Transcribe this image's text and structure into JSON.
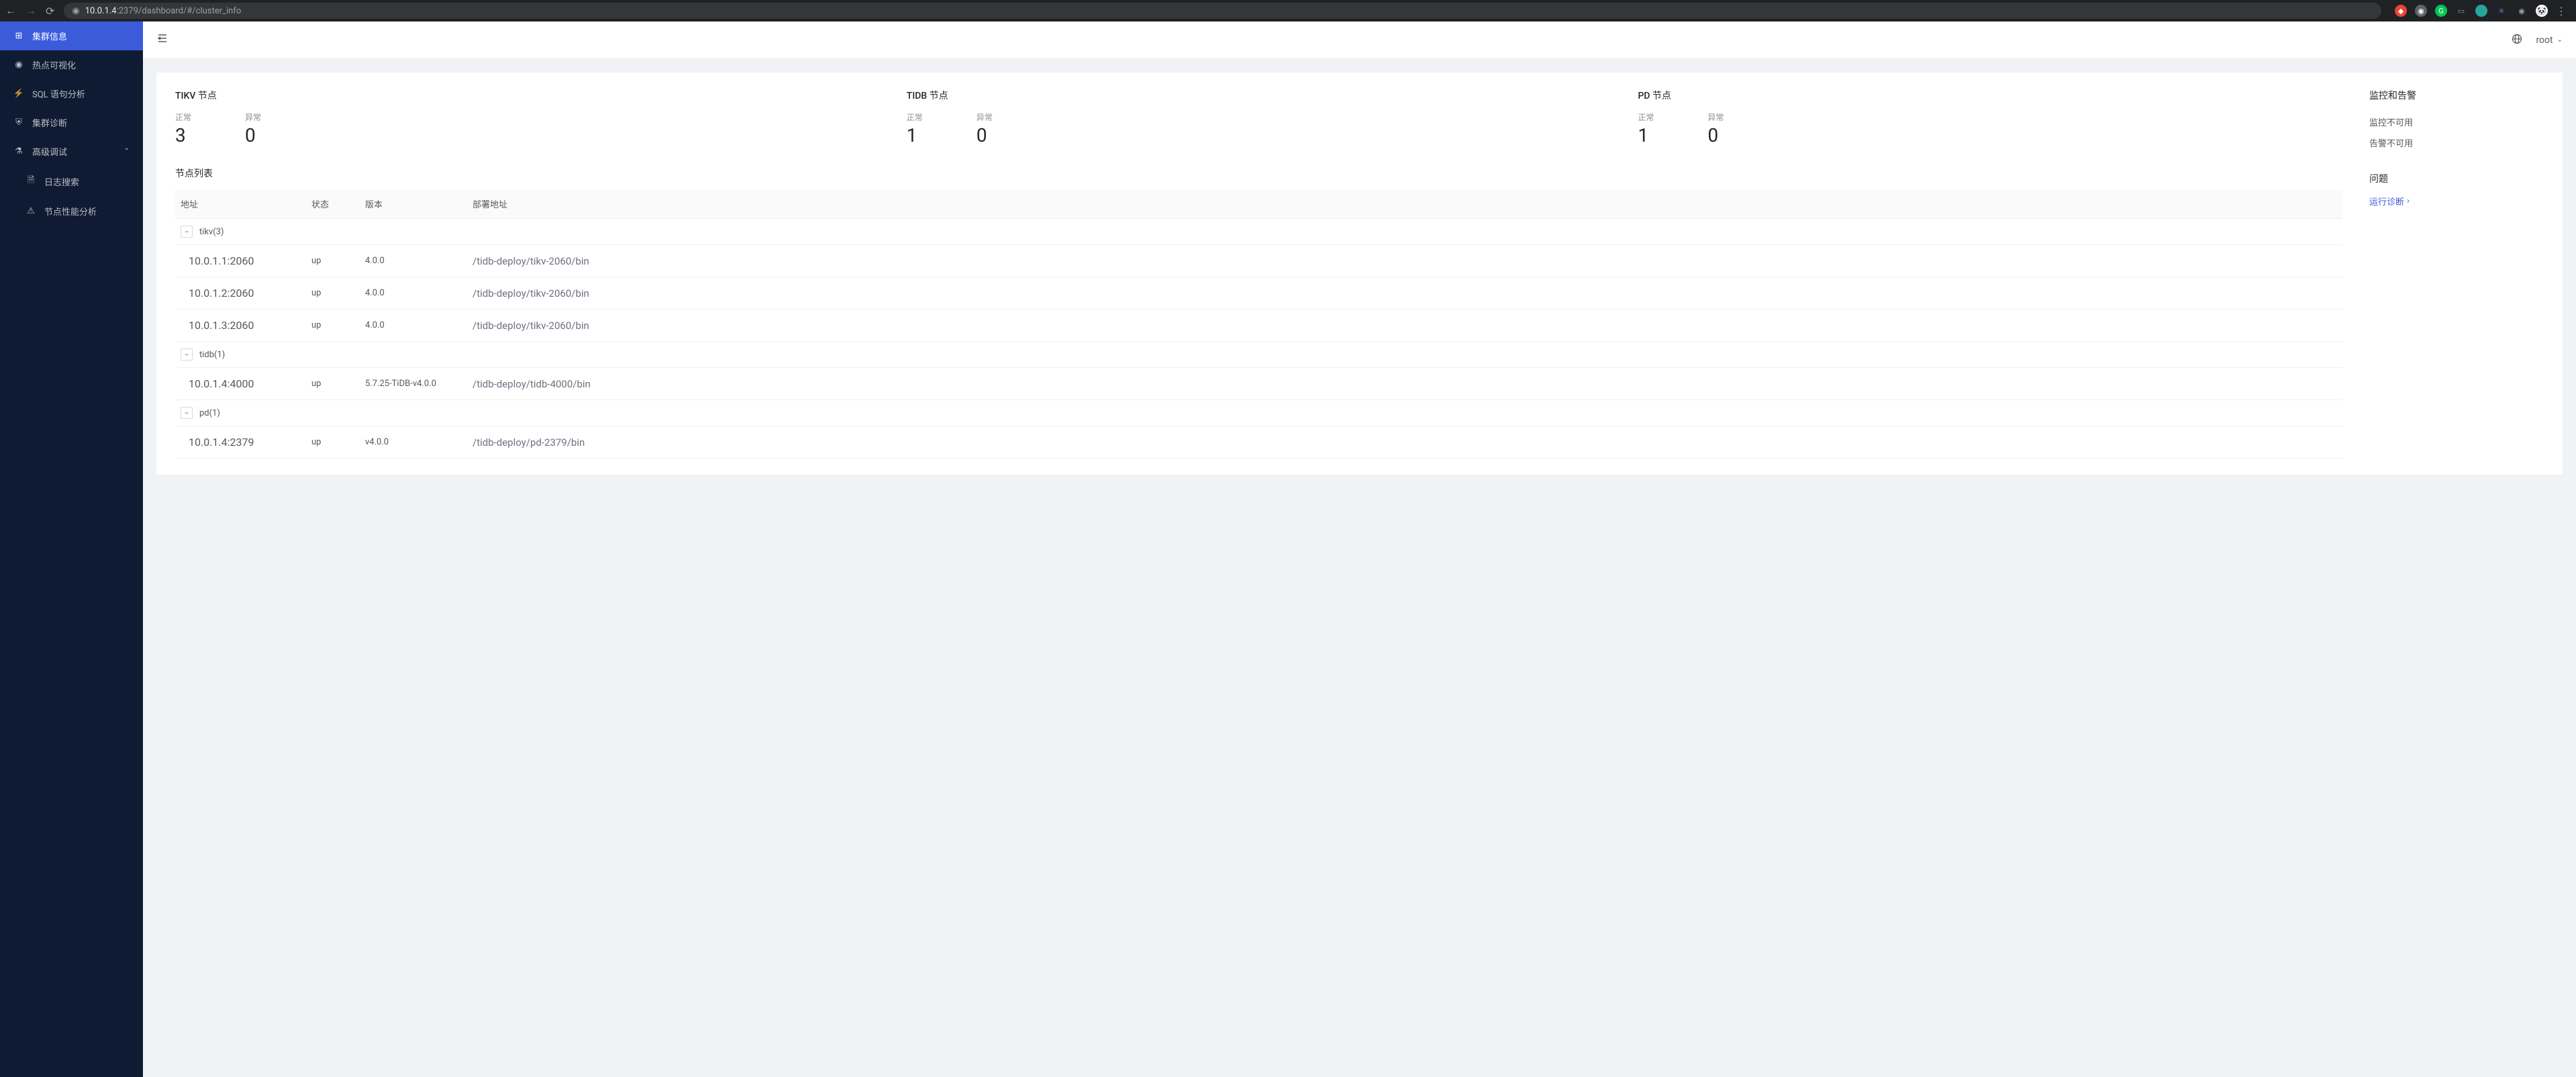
{
  "browser": {
    "url_host": "10.0.1.4",
    "url_port_path": ":2379/dashboard/#/cluster_info"
  },
  "sidebar": {
    "items": [
      {
        "label": "集群信息",
        "icon": "cluster"
      },
      {
        "label": "热点可视化",
        "icon": "eye"
      },
      {
        "label": "SQL 语句分析",
        "icon": "bolt"
      },
      {
        "label": "集群诊断",
        "icon": "shield"
      },
      {
        "label": "高级调试",
        "icon": "debug"
      }
    ],
    "sub_items": [
      {
        "label": "日志搜索",
        "icon": "file"
      },
      {
        "label": "节点性能分析",
        "icon": "warning"
      }
    ]
  },
  "topbar": {
    "user": "root"
  },
  "stats": {
    "tikv": {
      "title": "TIKV 节点",
      "normal_label": "正常",
      "normal": "3",
      "abnormal_label": "异常",
      "abnormal": "0"
    },
    "tidb": {
      "title": "TIDB 节点",
      "normal_label": "正常",
      "normal": "1",
      "abnormal_label": "异常",
      "abnormal": "0"
    },
    "pd": {
      "title": "PD 节点",
      "normal_label": "正常",
      "normal": "1",
      "abnormal_label": "异常",
      "abnormal": "0"
    }
  },
  "node_list": {
    "title": "节点列表",
    "columns": {
      "address": "地址",
      "status": "状态",
      "version": "版本",
      "deploy": "部署地址"
    },
    "groups": [
      {
        "name": "tikv(3)",
        "rows": [
          {
            "address": "10.0.1.1:2060",
            "status": "up",
            "version": "4.0.0",
            "deploy": "/tidb-deploy/tikv-2060/bin"
          },
          {
            "address": "10.0.1.2:2060",
            "status": "up",
            "version": "4.0.0",
            "deploy": "/tidb-deploy/tikv-2060/bin"
          },
          {
            "address": "10.0.1.3:2060",
            "status": "up",
            "version": "4.0.0",
            "deploy": "/tidb-deploy/tikv-2060/bin"
          }
        ]
      },
      {
        "name": "tidb(1)",
        "rows": [
          {
            "address": "10.0.1.4:4000",
            "status": "up",
            "version": "5.7.25-TiDB-v4.0.0",
            "deploy": "/tidb-deploy/tidb-4000/bin"
          }
        ]
      },
      {
        "name": "pd(1)",
        "rows": [
          {
            "address": "10.0.1.4:2379",
            "status": "up",
            "version": "v4.0.0",
            "deploy": "/tidb-deploy/pd-2379/bin"
          }
        ]
      }
    ]
  },
  "side": {
    "monitor_title": "监控和告警",
    "monitor_na": "监控不可用",
    "alert_na": "告警不可用",
    "problem_title": "问题",
    "run_diag": "运行诊断"
  }
}
